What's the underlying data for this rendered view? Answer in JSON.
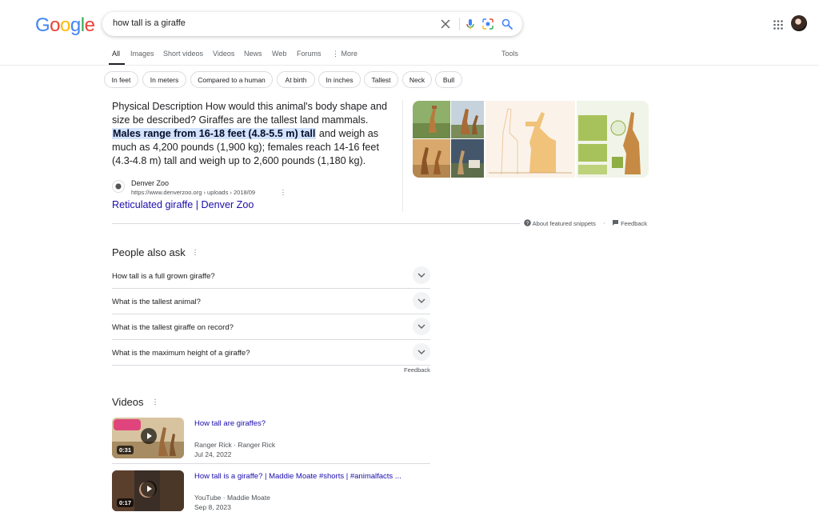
{
  "logo": {
    "letters": [
      "G",
      "o",
      "o",
      "g",
      "l",
      "e"
    ],
    "colors": [
      "#4285f4",
      "#ea4335",
      "#fbbc05",
      "#4285f4",
      "#34a853",
      "#ea4335"
    ]
  },
  "search": {
    "query": "how tall is a giraffe"
  },
  "tabs": [
    {
      "label": "All",
      "active": true
    },
    {
      "label": "Images"
    },
    {
      "label": "Short videos"
    },
    {
      "label": "Videos"
    },
    {
      "label": "News"
    },
    {
      "label": "Web"
    },
    {
      "label": "Forums"
    },
    {
      "label": "More"
    }
  ],
  "tools_label": "Tools",
  "chips": [
    "In feet",
    "In meters",
    "Compared to a human",
    "At birth",
    "In inches",
    "Tallest",
    "Neck",
    "Bull"
  ],
  "snippet": {
    "text_before": "Physical Description How would this animal's body shape and size be described? Giraffes are the tallest land mammals. ",
    "highlight": "Males range from 16-18 feet (4.8-5.5 m) tall",
    "text_after": " and weigh as much as 4,200 pounds (1,900 kg); females reach 14-16 feet (4.3-4.8 m) tall and weigh up to 2,600 pounds (1,180 kg).",
    "source_name": "Denver Zoo",
    "source_url": "https://www.denverzoo.org › uploads › 2018/09",
    "link_title": "Reticulated giraffe | Denver Zoo"
  },
  "about_snippets": "About featured snippets",
  "feedback": "Feedback",
  "paa": {
    "title": "People also ask",
    "questions": [
      "How tall is a full grown giraffe?",
      "What is the tallest animal?",
      "What is the tallest giraffe on record?",
      "What is the maximum height of a giraffe?"
    ],
    "feedback": "Feedback"
  },
  "videos": {
    "title": "Videos",
    "items": [
      {
        "title": "How tall are giraffes?",
        "source": "Ranger Rick · Ranger Rick",
        "date": "Jul 24, 2022",
        "duration": "0:31"
      },
      {
        "title": "How tall is a giraffe? | Maddie Moate #shorts | #animalfacts ...",
        "source": "YouTube · Maddie Moate",
        "date": "Sep 8, 2023",
        "duration": "0:17"
      }
    ]
  }
}
